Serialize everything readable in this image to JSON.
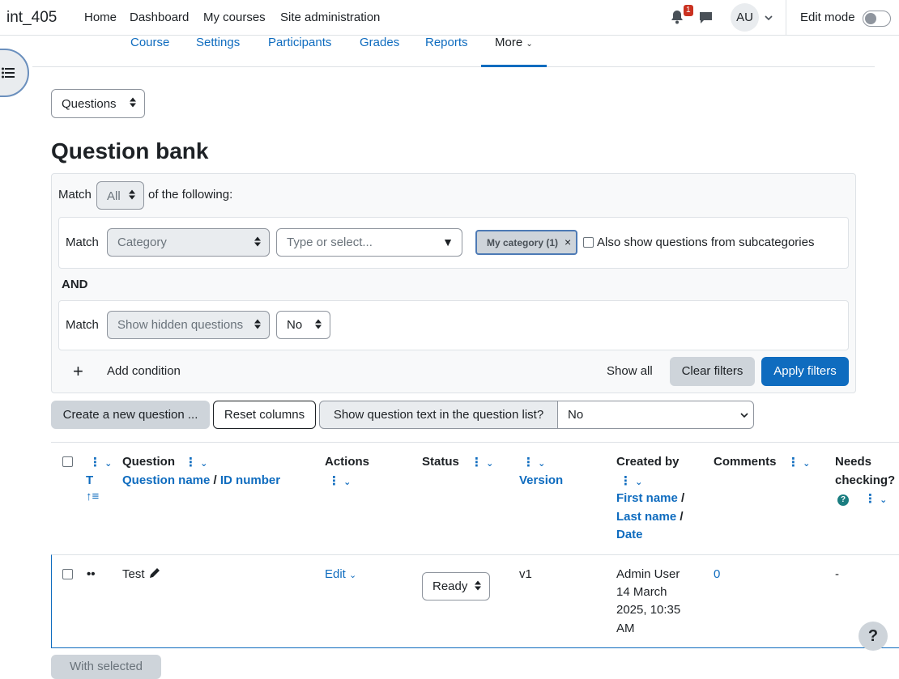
{
  "navbar": {
    "brand": "int_405",
    "links": [
      "Home",
      "Dashboard",
      "My courses",
      "Site administration"
    ],
    "notification_count": "1",
    "avatar_initials": "AU",
    "edit_mode_label": "Edit mode"
  },
  "secondary_nav": {
    "items": [
      "Course",
      "Settings",
      "Participants",
      "Grades",
      "Reports",
      "More"
    ]
  },
  "questions_select": {
    "value": "Questions"
  },
  "page_title": "Question bank",
  "filter": {
    "match_label": "Match",
    "match_all_value": "All",
    "of_following": "of the following:",
    "cond1": {
      "match_label": "Match",
      "type_value": "Category",
      "search_placeholder": "Type or select...",
      "selected_pill": "My category (1)",
      "subcat_label": "Also show questions from subcategories"
    },
    "and_label": "AND",
    "cond2": {
      "match_label": "Match",
      "type_value": "Show hidden questions",
      "value": "No"
    },
    "add_condition": "Add condition",
    "show_all": "Show all",
    "clear_filters": "Clear filters",
    "apply_filters": "Apply filters"
  },
  "toolbar": {
    "create_new": "Create a new question ...",
    "reset_columns": "Reset columns",
    "show_text_label": "Show question text in the question list?",
    "show_text_value": "No"
  },
  "table": {
    "col_type_sort": "T",
    "col_question": "Question",
    "col_question_name": "Question name",
    "col_id_number": "ID number",
    "col_actions": "Actions",
    "col_status": "Status",
    "col_version": "Version",
    "col_created_by": "Created by",
    "col_first_name": "First name",
    "col_last_name": "Last name",
    "col_date": "Date",
    "col_comments": "Comments",
    "col_needs_checking_1": "Needs",
    "col_needs_checking_2": "checking?",
    "row": {
      "question": "Test",
      "action": "Edit",
      "status": "Ready",
      "version": "v1",
      "created_by_1": "Admin User",
      "created_by_2": "14 March",
      "created_by_3": "2025, 10:35",
      "created_by_4": "AM",
      "comments": "0",
      "needs_checking": "-"
    }
  },
  "bottom_button": "With selected",
  "help": "?",
  "colors": {
    "primary": "#0f6cbf",
    "secondary": "#ced4da",
    "danger": "#ca3120",
    "info": "#1a7d80"
  }
}
